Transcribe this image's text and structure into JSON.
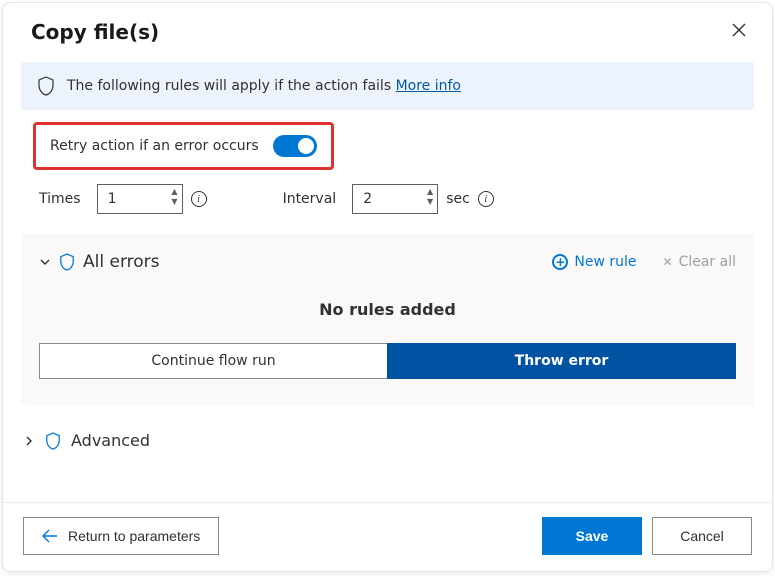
{
  "header": {
    "title": "Copy file(s)"
  },
  "banner": {
    "text": "The following rules will apply if the action fails ",
    "link_label": "More info"
  },
  "retry": {
    "toggle_label": "Retry action if an error occurs",
    "toggle_on": true,
    "times_label": "Times",
    "times_value": "1",
    "interval_label": "Interval",
    "interval_value": "2",
    "interval_unit": "sec"
  },
  "errors_panel": {
    "title": "All errors",
    "new_rule_label": "New rule",
    "clear_all_label": "Clear all",
    "empty_text": "No rules added",
    "continue_label": "Continue flow run",
    "throw_label": "Throw error"
  },
  "advanced": {
    "label": "Advanced"
  },
  "footer": {
    "return_label": "Return to parameters",
    "save_label": "Save",
    "cancel_label": "Cancel"
  }
}
